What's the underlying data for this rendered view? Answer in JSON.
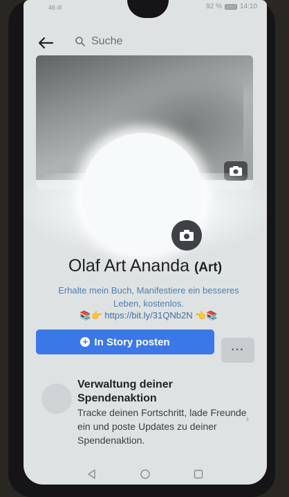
{
  "status_bar": {
    "left_text": "46·ill",
    "right_text": "92 %",
    "time": "14:10"
  },
  "topbar": {
    "search_placeholder": "Suche"
  },
  "profile": {
    "name": "Olaf Art Ananda",
    "alternate_name": "(Art)",
    "bio_line": "Erhalte mein  Buch, Manifestiere ein besseres Leben, kostenlos.",
    "bio_link": "📚👉 https://bit.ly/31QNb2N 👈📚"
  },
  "actions": {
    "story_button_label": "In Story posten",
    "more_button_label": "···"
  },
  "fundraiser": {
    "title": "Verwaltung deiner Spendenaktion",
    "text": "Tracke deinen Fortschritt, lade Freunde ein und poste Updates zu deiner Spendenaktion."
  },
  "colors": {
    "accent": "#3b78e7",
    "bio_text": "#4a7fb0"
  },
  "icons": [
    "back-arrow-icon",
    "search-icon",
    "camera-icon",
    "plus-icon",
    "nav-back-icon",
    "nav-home-icon",
    "nav-recents-icon"
  ]
}
